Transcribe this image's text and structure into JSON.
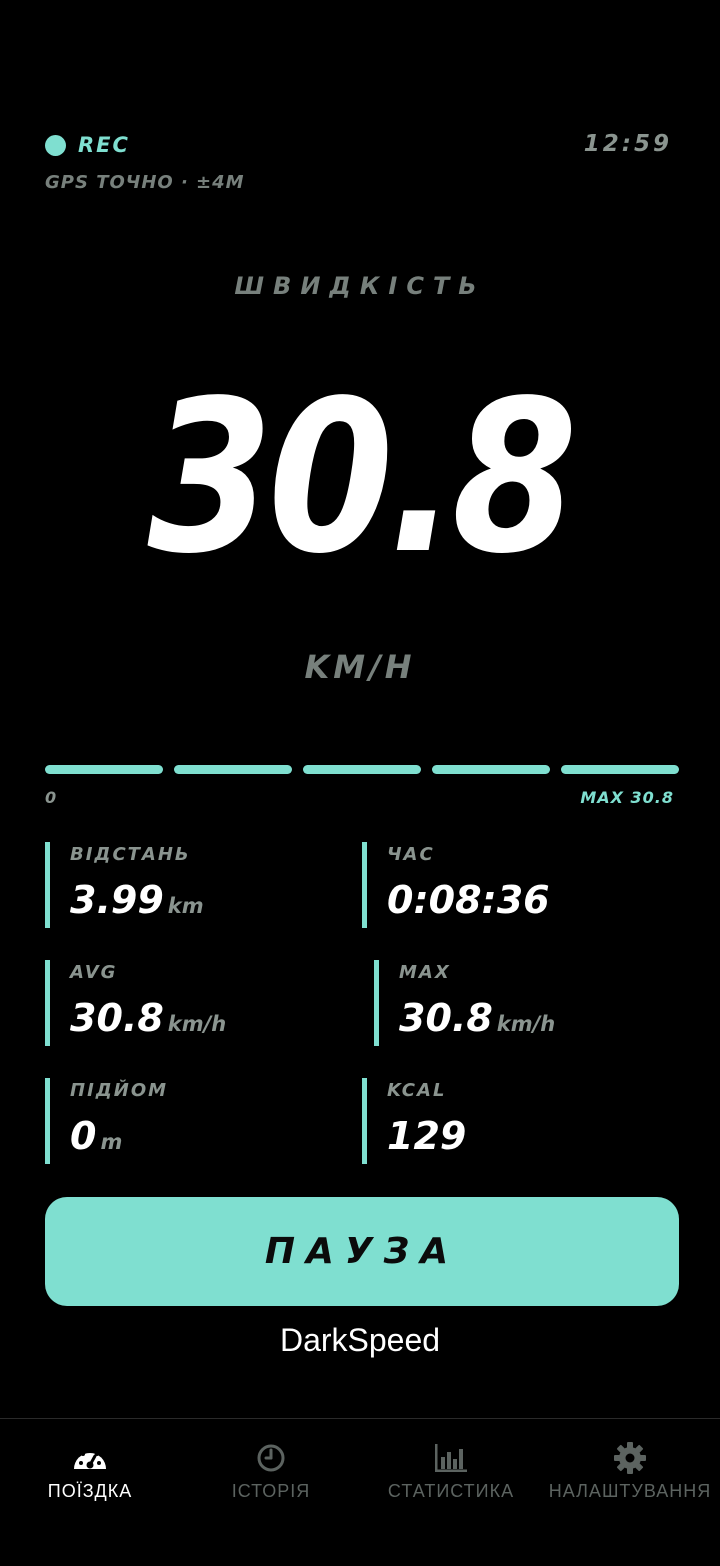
{
  "status": {
    "rec_label": "REC",
    "clock": "12:59",
    "gps": "GPS ТОЧНО · ±4M"
  },
  "speed": {
    "title": "ШВИДКІСТЬ",
    "value": "30.8",
    "unit": "KM/H"
  },
  "speed_bar": {
    "min_label": "0",
    "max_label": "MAX 30.8",
    "fill_fraction": 1.0
  },
  "stats": [
    {
      "label": "ВІДСТАНЬ",
      "value": "3.99",
      "unit": "km"
    },
    {
      "label": "ЧАС",
      "value": "0:08:36",
      "unit": ""
    },
    {
      "label": "AVG",
      "value": "30.8",
      "unit": "km/h"
    },
    {
      "label": "MAX",
      "value": "30.8",
      "unit": "km/h"
    },
    {
      "label": "ПІДЙОМ",
      "value": "0",
      "unit": "m"
    },
    {
      "label": "KCAL",
      "value": "129",
      "unit": ""
    }
  ],
  "pause_label": "ПАУЗА",
  "brand": "DarkSpeed",
  "nav": {
    "items": [
      {
        "label": "ПОЇЗДКА",
        "icon": "speedometer-icon",
        "active": true
      },
      {
        "label": "ІСТОРІЯ",
        "icon": "clock-icon",
        "active": false
      },
      {
        "label": "СТАТИСТИКА",
        "icon": "bar-chart-icon",
        "active": false
      },
      {
        "label": "НАЛАШТУВАННЯ",
        "icon": "gear-icon",
        "active": false
      }
    ]
  },
  "colors": {
    "accent": "#7fdfd0",
    "background": "#000000",
    "muted": "#8a948f",
    "inactive_nav": "#5c6360"
  }
}
